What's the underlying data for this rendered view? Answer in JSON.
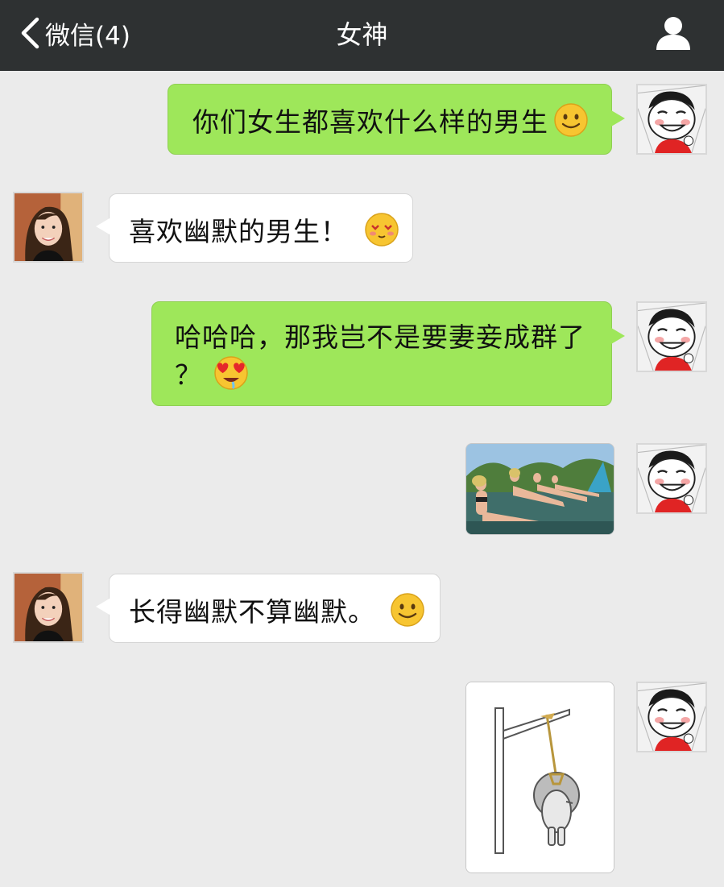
{
  "header": {
    "back_label": "微信(4)",
    "title": "女神"
  },
  "messages": [
    {
      "sender": "me",
      "text": "你们女生都喜欢什么样的男生",
      "emoji": "smile-emoji"
    },
    {
      "sender": "her",
      "text": "喜欢幽默的男生！",
      "emoji": "shy-heart-eyes-emoji"
    },
    {
      "sender": "me",
      "text_line1": "哈哈哈，那我岂不是要妻妾成群了",
      "text_line2": "？",
      "emoji": "heart-eyes-drool-emoji"
    },
    {
      "sender": "me",
      "image": "photo-women-lounge-chairs"
    },
    {
      "sender": "her",
      "text": "长得幽默不算幽默。",
      "emoji": "smile-emoji"
    },
    {
      "sender": "me",
      "image": "hanging-cartoon-sticker"
    }
  ],
  "colors": {
    "topbar": "#2e3132",
    "background": "#ebebeb",
    "my_bubble": "#9ee75a",
    "her_bubble": "#ffffff"
  }
}
